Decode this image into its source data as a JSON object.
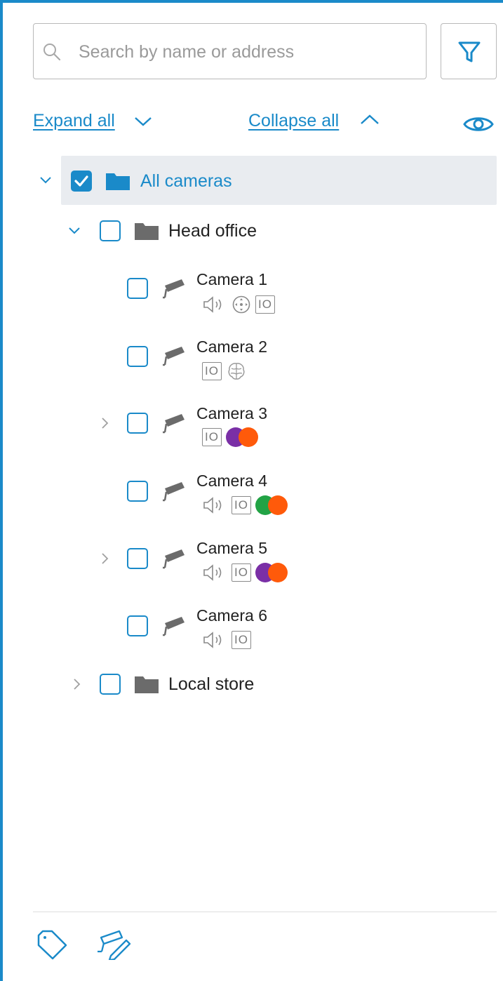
{
  "search": {
    "placeholder": "Search by name or address",
    "value": ""
  },
  "toolbar": {
    "expand_all": "Expand all",
    "collapse_all": "Collapse all"
  },
  "tree": {
    "root": {
      "label": "All cameras",
      "checked": true
    },
    "head_office": {
      "label": "Head office"
    },
    "cameras": [
      {
        "name": "Camera 1",
        "features": [
          "speaker-icon",
          "ptz-icon",
          "io-icon"
        ]
      },
      {
        "name": "Camera 2",
        "features": [
          "io-icon",
          "brain-icon"
        ]
      },
      {
        "name": "Camera 3",
        "features": [
          "io-icon",
          "purple-orange-dots"
        ]
      },
      {
        "name": "Camera 4",
        "features": [
          "speaker-icon",
          "io-icon",
          "green-orange-dots"
        ]
      },
      {
        "name": "Camera 5",
        "features": [
          "speaker-icon",
          "io-icon",
          "purple-orange-dots"
        ]
      },
      {
        "name": "Camera 6",
        "features": [
          "speaker-icon",
          "io-icon"
        ]
      }
    ],
    "io_label": "IO",
    "local_store": {
      "label": "Local store"
    }
  },
  "colors": {
    "accent": "#1a8ac9",
    "purple": "#7a2fa6",
    "orange": "#ff5a0a",
    "green": "#22a345",
    "selected_row": "#e9ecf0"
  }
}
